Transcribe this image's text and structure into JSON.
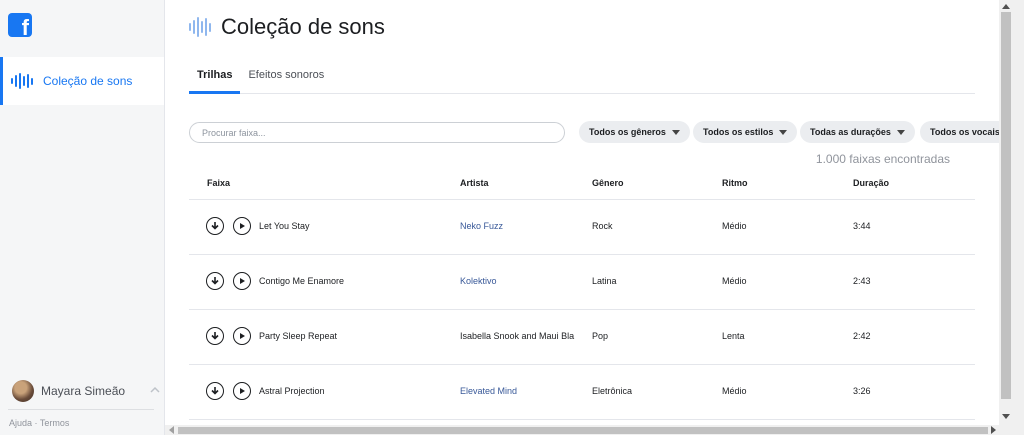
{
  "app": {
    "logo": "facebook-logo"
  },
  "sidebar": {
    "active_item": {
      "label": "Coleção de sons",
      "icon": "sound-bars-icon"
    },
    "user": {
      "name": "Mayara Simeão"
    },
    "footer": {
      "help": "Ajuda",
      "separator": "·",
      "terms": "Termos"
    }
  },
  "header": {
    "title": "Coleção de sons"
  },
  "tabs": [
    {
      "label": "Trilhas",
      "active": true
    },
    {
      "label": "Efeitos sonoros",
      "active": false
    }
  ],
  "search": {
    "placeholder": "Procurar faixa...",
    "value": ""
  },
  "filters": [
    {
      "label": "Todos os gêneros"
    },
    {
      "label": "Todos os estilos"
    },
    {
      "label": "Todas as durações"
    },
    {
      "label": "Todos os vocais"
    }
  ],
  "results": {
    "count_text": "1.000 faixas encontradas"
  },
  "table": {
    "columns": [
      "Faixa",
      "Artista",
      "Gênero",
      "Ritmo",
      "Duração"
    ],
    "rows": [
      {
        "track": "Let You Stay",
        "artist": "Neko Fuzz",
        "genre": "Rock",
        "tempo": "Médio",
        "duration": "3:44",
        "artist_is_link": true
      },
      {
        "track": "Contigo Me Enamore",
        "artist": "Kolektivo",
        "genre": "Latina",
        "tempo": "Médio",
        "duration": "2:43",
        "artist_is_link": true
      },
      {
        "track": "Party Sleep Repeat",
        "artist": "Isabella Snook and Maui Bla",
        "genre": "Pop",
        "tempo": "Lenta",
        "duration": "2:42",
        "artist_is_link": false
      },
      {
        "track": "Astral Projection",
        "artist": "Elevated Mind",
        "genre": "Eletrônica",
        "tempo": "Médio",
        "duration": "3:26",
        "artist_is_link": true
      }
    ]
  },
  "colors": {
    "accent": "#1877f2",
    "link": "#385898",
    "muted": "#90949c"
  }
}
